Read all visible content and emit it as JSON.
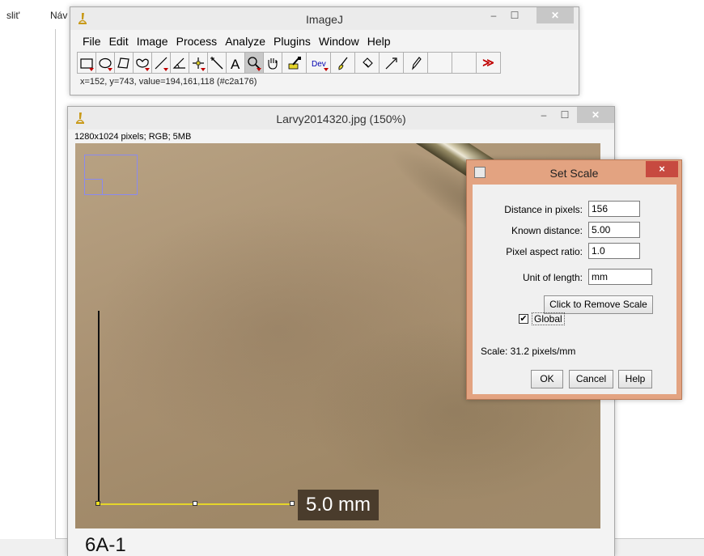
{
  "background_app": {
    "labels": [
      "slit'",
      "Náv"
    ]
  },
  "imagej": {
    "title": "ImageJ",
    "menu": [
      "File",
      "Edit",
      "Image",
      "Process",
      "Analyze",
      "Plugins",
      "Window",
      "Help"
    ],
    "status": "x=152, y=743, value=194,161,118 (#c2a176)",
    "dev_tool_label": "Dev",
    "more_tools_label": "≫"
  },
  "image_window": {
    "title": "Larvy2014320.jpg (150%)",
    "info": "1280x1024 pixels; RGB; 5MB",
    "scale_bar_text": "5.0 mm",
    "sample_label": "6A-1"
  },
  "set_scale": {
    "title": "Set Scale",
    "distance_label": "Distance in pixels:",
    "distance_value": "156",
    "known_label": "Known distance:",
    "known_value": "5.00",
    "aspect_label": "Pixel aspect ratio:",
    "aspect_value": "1.0",
    "unit_label": "Unit of length:",
    "unit_value": "mm",
    "remove_scale_label": "Click to Remove Scale",
    "global_label": "Global",
    "global_checked": true,
    "scale_readout": "Scale: 31.2 pixels/mm",
    "ok_label": "OK",
    "cancel_label": "Cancel",
    "help_label": "Help",
    "close_glyph": "×"
  },
  "colors": {
    "dialog_frame": "#e3a381",
    "dialog_close": "#c74a40",
    "scale_line": "#e5d52a",
    "scale_label_bg": "#4a3c2c",
    "tool_arrow": "#c00000"
  },
  "icons": [
    "rectangle-icon",
    "oval-icon",
    "polygon-icon",
    "freehand-icon",
    "line-icon",
    "angle-icon",
    "point-icon",
    "wand-icon",
    "text-icon",
    "magnifier-icon",
    "hand-icon",
    "dropper-icon",
    "dev-icon",
    "brush-icon",
    "flood-fill-icon",
    "arrow-icon",
    "pencil-icon",
    "more-tools-icon"
  ]
}
